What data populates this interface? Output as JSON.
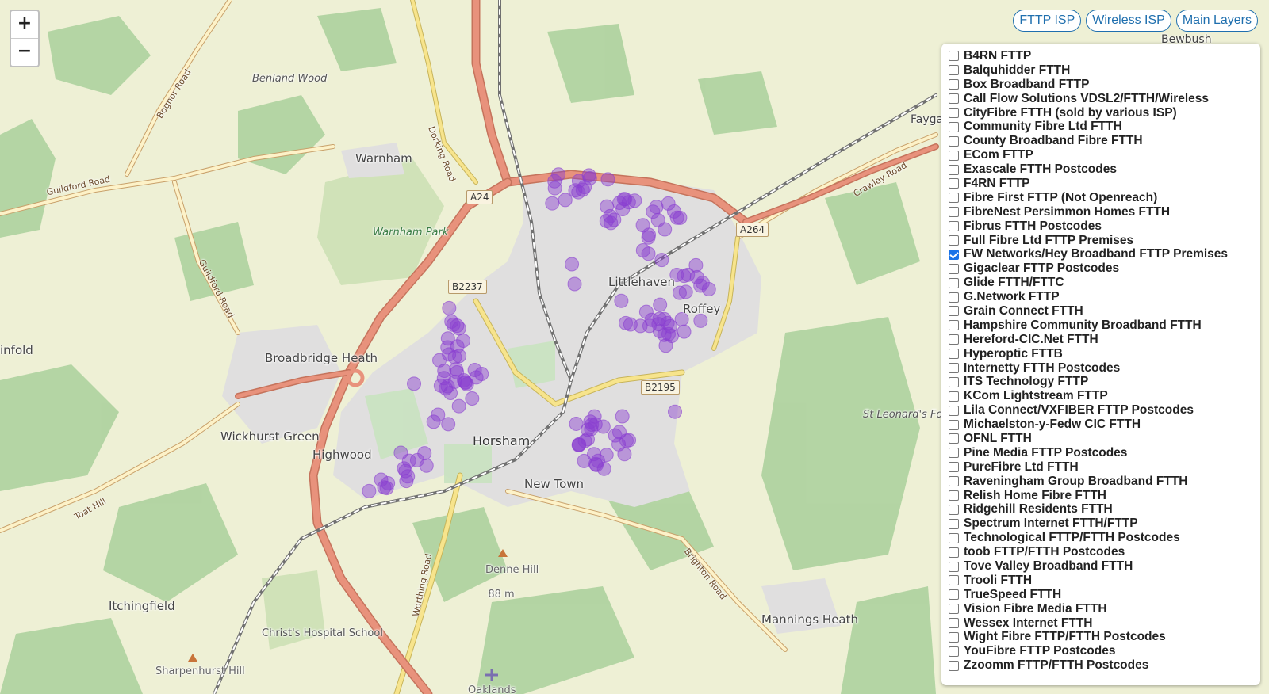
{
  "zoom": {
    "in_label": "+",
    "out_label": "−"
  },
  "layer_buttons": [
    "FTTP ISP",
    "Wireless ISP",
    "Main Layers"
  ],
  "isp_layers": [
    {
      "label": "B4RN FTTP",
      "checked": false
    },
    {
      "label": "Balquhidder FTTH",
      "checked": false
    },
    {
      "label": "Box Broadband FTTP",
      "checked": false
    },
    {
      "label": "Call Flow Solutions VDSL2/FTTH/Wireless",
      "checked": false
    },
    {
      "label": "CityFibre FTTH (sold by various ISP)",
      "checked": false
    },
    {
      "label": "Community Fibre Ltd FTTH",
      "checked": false
    },
    {
      "label": "County Broadband Fibre FTTH",
      "checked": false
    },
    {
      "label": "ECom FTTP",
      "checked": false
    },
    {
      "label": "Exascale FTTH Postcodes",
      "checked": false
    },
    {
      "label": "F4RN FTTP",
      "checked": false
    },
    {
      "label": "Fibre First FTTP (Not Openreach)",
      "checked": false
    },
    {
      "label": "FibreNest Persimmon Homes FTTH",
      "checked": false
    },
    {
      "label": "Fibrus FTTH Postcodes",
      "checked": false
    },
    {
      "label": "Full Fibre Ltd FTTP Premises",
      "checked": false
    },
    {
      "label": "FW Networks/Hey Broadband FTTP Premises",
      "checked": true
    },
    {
      "label": "Gigaclear FTTP Postcodes",
      "checked": false
    },
    {
      "label": "Glide FTTH/FTTC",
      "checked": false
    },
    {
      "label": "G.Network FTTP",
      "checked": false
    },
    {
      "label": "Grain Connect FTTH",
      "checked": false
    },
    {
      "label": "Hampshire Community Broadband FTTH",
      "checked": false
    },
    {
      "label": "Hereford-CIC.Net FTTH",
      "checked": false
    },
    {
      "label": "Hyperoptic FTTB",
      "checked": false
    },
    {
      "label": "Internetty FTTH Postcodes",
      "checked": false
    },
    {
      "label": "ITS Technology FTTP",
      "checked": false
    },
    {
      "label": "KCom Lightstream FTTP",
      "checked": false
    },
    {
      "label": "Lila Connect/VXFIBER FTTP Postcodes",
      "checked": false
    },
    {
      "label": "Michaelston-y-Fedw CIC FTTH",
      "checked": false
    },
    {
      "label": "OFNL FTTH",
      "checked": false
    },
    {
      "label": "Pine Media FTTP Postcodes",
      "checked": false
    },
    {
      "label": "PureFibre Ltd FTTH",
      "checked": false
    },
    {
      "label": "Raveningham Group Broadband FTTH",
      "checked": false
    },
    {
      "label": "Relish Home Fibre FTTH",
      "checked": false
    },
    {
      "label": "Ridgehill Residents FTTH",
      "checked": false
    },
    {
      "label": "Spectrum Internet FTTH/FTTP",
      "checked": false
    },
    {
      "label": "Technological FTTP/FTTH Postcodes",
      "checked": false
    },
    {
      "label": "toob FTTP/FTTH Postcodes",
      "checked": false
    },
    {
      "label": "Tove Valley Broadband FTTH",
      "checked": false
    },
    {
      "label": "Trooli FTTH",
      "checked": false
    },
    {
      "label": "TrueSpeed FTTH",
      "checked": false
    },
    {
      "label": "Vision Fibre Media FTTH",
      "checked": false
    },
    {
      "label": "Wessex Internet FTTH",
      "checked": false
    },
    {
      "label": "Wight Fibre FTTP/FTTH Postcodes",
      "checked": false
    },
    {
      "label": "YouFibre FTTP Postcodes",
      "checked": false
    },
    {
      "label": "Zzoomm FTTP/FTTH Postcodes",
      "checked": false
    }
  ],
  "map_labels": {
    "horsham": "Horsham",
    "littlehaven": "Littlehaven",
    "roffey": "Roffey",
    "new_town": "New Town",
    "warnham": "Warnham",
    "broadbridge_heath": "Broadbridge Heath",
    "wickhurst_green": "Wickhurst Green",
    "highwood": "Highwood",
    "itchingfield": "Itchingfield",
    "mannings_heath": "Mannings Heath",
    "benland_wood": "Benland Wood",
    "warnham_park": "Warnham Park",
    "st_leonards_forest": "St Leonard's Forest",
    "denne_hill": "Denne Hill",
    "denne_hill_elev": "88 m",
    "christs_hospital_school": "Christ's Hospital School",
    "sharpenhurst_hill": "Sharpenhurst Hill",
    "bewbush": "Bewbush",
    "faygate": "Fayga",
    "infold": "infold",
    "oaklands": "Oaklands",
    "guildford_road_1": "Guildford Road",
    "guildford_road_2": "Guildford Road",
    "bognor_road": "Bognor Road",
    "dorking_road": "Dorking Road",
    "crawley_road": "Crawley Road",
    "toat_hill": "Toat Hill",
    "worthing_road": "Worthing Road",
    "brighton_road": "Brighton Road",
    "a24": "A24",
    "a264": "A264",
    "b2237": "B2237",
    "b2195": "B2195"
  },
  "colors": {
    "marker": "#8a3fd1",
    "accent": "#1f6fae",
    "primary_road": "#e8927c",
    "secondary_road": "#f7e48c",
    "railway": "#707070",
    "woodland": "#add19e",
    "farmland": "#eef0d5",
    "residential": "#e0dfdf"
  }
}
